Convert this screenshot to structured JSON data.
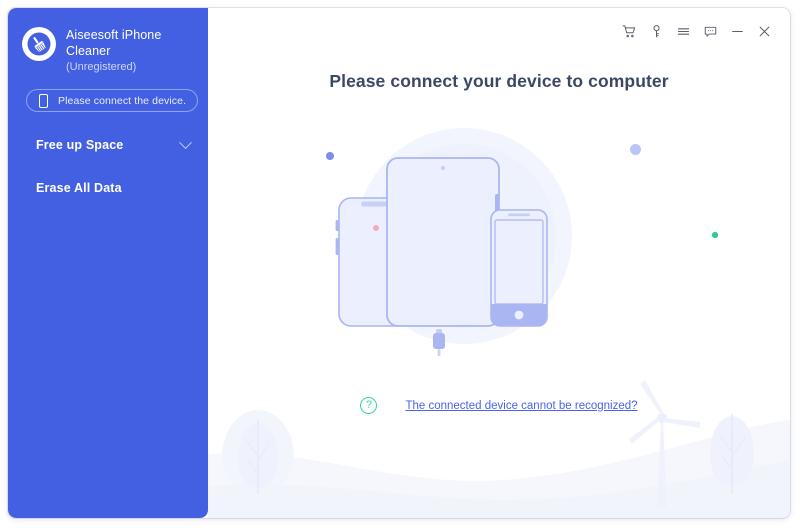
{
  "window": {
    "title": "Aiseesoft iPhone Cleaner"
  },
  "sidebar": {
    "brand": {
      "logo_icon": "broom-cleaner-icon",
      "name": "Aiseesoft iPhone Cleaner",
      "registration": "(Unregistered)"
    },
    "connect_pill": {
      "icon": "phone-icon",
      "label": "Please connect the device."
    },
    "nav_items": [
      {
        "label": "Free up Space",
        "icon": "chevron-down-icon",
        "expandable": true
      },
      {
        "label": "Erase All Data",
        "icon": "",
        "expandable": false
      }
    ]
  },
  "titlebar": {
    "buttons": [
      {
        "name": "cart-icon",
        "title": "Buy"
      },
      {
        "name": "key-icon",
        "title": "Register"
      },
      {
        "name": "menu-icon",
        "title": "Menu"
      },
      {
        "name": "chat-icon",
        "title": "Feedback"
      },
      {
        "name": "minimize-icon",
        "title": "Minimize"
      },
      {
        "name": "close-icon",
        "title": "Close"
      }
    ]
  },
  "main": {
    "headline": "Please connect your device to computer",
    "illustration": "devices-and-lightning-cable-illustration",
    "help": {
      "icon": "question-circle-icon",
      "link_text": "The connected device cannot be recognized?"
    },
    "decor_dots": [
      {
        "name": "dot-violet",
        "color": "#7b8bf0"
      },
      {
        "name": "dot-pink",
        "color": "#f9a8c0"
      },
      {
        "name": "dot-blue",
        "color": "#b9c6f4"
      },
      {
        "name": "dot-green",
        "color": "#2ecb8e"
      }
    ],
    "scenery": [
      "tree-left",
      "hills",
      "windmill-icon",
      "tree-right"
    ]
  },
  "colors": {
    "sidebar_bg": "#4360e2",
    "accent_link": "#4a63e8",
    "accent_green": "#3ed1a0",
    "headline": "#3c4766",
    "device_fill": "#eceffd",
    "device_stroke": "#a9b6f2"
  }
}
